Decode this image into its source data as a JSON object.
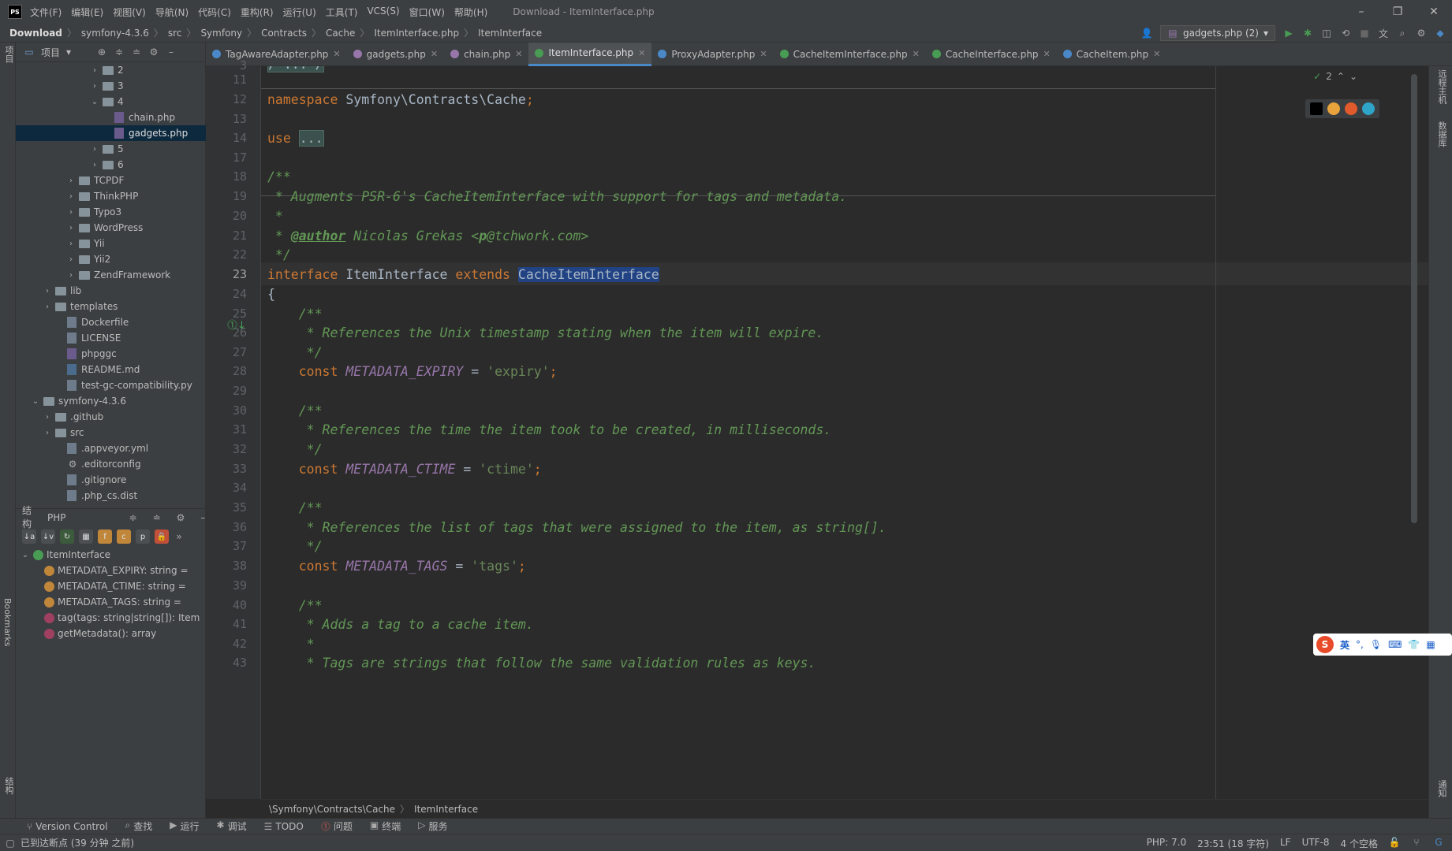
{
  "titlebar": {
    "logo": "PS",
    "menus": [
      "文件(F)",
      "编辑(E)",
      "视图(V)",
      "导航(N)",
      "代码(C)",
      "重构(R)",
      "运行(U)",
      "工具(T)",
      "VCS(S)",
      "窗口(W)",
      "帮助(H)"
    ],
    "window_title": "Download - ItemInterface.php"
  },
  "breadcrumbs": [
    "Download",
    "symfony-4.3.6",
    "src",
    "Symfony",
    "Contracts",
    "Cache",
    "ItemInterface.php",
    "ItemInterface"
  ],
  "run_config": "gadgets.php (2)",
  "left_stripe": {
    "top": "项目",
    "bookmarks": "Bookmarks",
    "structure": "结构"
  },
  "project_panel": {
    "title": "项目",
    "tree": [
      {
        "label": "2",
        "type": "folder",
        "indent": 6,
        "arrow": "›"
      },
      {
        "label": "3",
        "type": "folder",
        "indent": 6,
        "arrow": "›"
      },
      {
        "label": "4",
        "type": "folder",
        "indent": 6,
        "arrow": "⌄"
      },
      {
        "label": "chain.php",
        "type": "php",
        "indent": 7,
        "arrow": ""
      },
      {
        "label": "gadgets.php",
        "type": "php",
        "indent": 7,
        "arrow": "",
        "selected": true
      },
      {
        "label": "5",
        "type": "folder",
        "indent": 6,
        "arrow": "›"
      },
      {
        "label": "6",
        "type": "folder",
        "indent": 6,
        "arrow": "›"
      },
      {
        "label": "TCPDF",
        "type": "folder",
        "indent": 4,
        "arrow": "›"
      },
      {
        "label": "ThinkPHP",
        "type": "folder",
        "indent": 4,
        "arrow": "›"
      },
      {
        "label": "Typo3",
        "type": "folder",
        "indent": 4,
        "arrow": "›"
      },
      {
        "label": "WordPress",
        "type": "folder",
        "indent": 4,
        "arrow": "›"
      },
      {
        "label": "Yii",
        "type": "folder",
        "indent": 4,
        "arrow": "›"
      },
      {
        "label": "Yii2",
        "type": "folder",
        "indent": 4,
        "arrow": "›"
      },
      {
        "label": "ZendFramework",
        "type": "folder",
        "indent": 4,
        "arrow": "›"
      },
      {
        "label": "lib",
        "type": "folder",
        "indent": 2,
        "arrow": "›"
      },
      {
        "label": "templates",
        "type": "folder",
        "indent": 2,
        "arrow": "›"
      },
      {
        "label": "Dockerfile",
        "type": "file",
        "indent": 3,
        "arrow": ""
      },
      {
        "label": "LICENSE",
        "type": "file",
        "indent": 3,
        "arrow": ""
      },
      {
        "label": "phpggc",
        "type": "php",
        "indent": 3,
        "arrow": ""
      },
      {
        "label": "README.md",
        "type": "md",
        "indent": 3,
        "arrow": ""
      },
      {
        "label": "test-gc-compatibility.py",
        "type": "file",
        "indent": 3,
        "arrow": ""
      },
      {
        "label": "symfony-4.3.6",
        "type": "folder",
        "indent": 1,
        "arrow": "⌄"
      },
      {
        "label": ".github",
        "type": "folder",
        "indent": 2,
        "arrow": "›"
      },
      {
        "label": "src",
        "type": "folder",
        "indent": 2,
        "arrow": "›"
      },
      {
        "label": ".appveyor.yml",
        "type": "file",
        "indent": 3,
        "arrow": ""
      },
      {
        "label": ".editorconfig",
        "type": "gear",
        "indent": 3,
        "arrow": ""
      },
      {
        "label": ".gitignore",
        "type": "file",
        "indent": 3,
        "arrow": ""
      },
      {
        "label": ".php_cs.dist",
        "type": "file",
        "indent": 3,
        "arrow": ""
      }
    ]
  },
  "structure_panel": {
    "tabs": [
      "结构",
      "PHP"
    ],
    "root": "ItemInterface",
    "items": [
      "METADATA_EXPIRY: string =",
      "METADATA_CTIME: string =",
      "METADATA_TAGS: string =",
      "tag(tags: string|string[]): Item",
      "getMetadata(): array"
    ]
  },
  "tabs": [
    {
      "label": "TagAwareAdapter.php",
      "color": "#4a88c7",
      "active": false
    },
    {
      "label": "gadgets.php",
      "color": "#9876aa",
      "active": false
    },
    {
      "label": "chain.php",
      "color": "#9876aa",
      "active": false
    },
    {
      "label": "ItemInterface.php",
      "color": "#499c54",
      "active": true
    },
    {
      "label": "ProxyAdapter.php",
      "color": "#4a88c7",
      "active": false
    },
    {
      "label": "CacheItemInterface.php",
      "color": "#499c54",
      "active": false
    },
    {
      "label": "CacheInterface.php",
      "color": "#499c54",
      "active": false
    },
    {
      "label": "CacheItem.php",
      "color": "#4a88c7",
      "active": false
    }
  ],
  "inspection_count": "2",
  "code": {
    "line_numbers": [
      "3",
      "11",
      "12",
      "13",
      "14",
      "17",
      "18",
      "19",
      "20",
      "21",
      "22",
      "23",
      "24",
      "25",
      "26",
      "27",
      "28",
      "29",
      "30",
      "31",
      "32",
      "33",
      "34",
      "35",
      "36",
      "37",
      "38",
      "39",
      "40",
      "41",
      "42",
      "43"
    ],
    "l3": "/*...*/",
    "l12_kw": "namespace",
    "l12_ns": " Symfony\\Contracts\\Cache",
    "l12_end": ";",
    "l14_kw": "use",
    "l14_fold": "...",
    "l18": "/**",
    "l19": " * Augments PSR-6's CacheItemInterface with support for tags and metadata.",
    "l20": " *",
    "l21_a": " * ",
    "l21_tag": "@author",
    "l21_b": " Nicolas Grekas <",
    "l21_p": "p",
    "l21_c": "@tchwork.com>",
    "l22": " */",
    "l23_kw1": "interface",
    "l23_name": " ItemInterface ",
    "l23_kw2": "extends",
    "l23_sp": " ",
    "l23_parent": "CacheItemInterface",
    "l24": "{",
    "l25": "    /**",
    "l26": "     * References the Unix timestamp stating when the item will expire.",
    "l27": "     */",
    "l28_kw": "    const",
    "l28_c": " METADATA_EXPIRY",
    "l28_eq": " = ",
    "l28_s": "'expiry'",
    "l28_end": ";",
    "l30": "    /**",
    "l31": "     * References the time the item took to be created, in milliseconds.",
    "l32": "     */",
    "l33_kw": "    const",
    "l33_c": " METADATA_CTIME",
    "l33_eq": " = ",
    "l33_s": "'ctime'",
    "l33_end": ";",
    "l35": "    /**",
    "l36": "     * References the list of tags that were assigned to the item, as string[].",
    "l37": "     */",
    "l38_kw": "    const",
    "l38_c": " METADATA_TAGS",
    "l38_eq": " = ",
    "l38_s": "'tags'",
    "l38_end": ";",
    "l40": "    /**",
    "l41": "     * Adds a tag to a cache item.",
    "l42": "     *",
    "l43": "     * Tags are strings that follow the same validation rules as keys."
  },
  "editor_breadcrumb": [
    "\\Symfony\\Contracts\\Cache",
    "ItemInterface"
  ],
  "toolwindows": [
    "Version Control",
    "查找",
    "运行",
    "调试",
    "TODO",
    "问题",
    "终端",
    "服务"
  ],
  "status": {
    "left": "已到达断点 (39 分钟 之前)",
    "php": "PHP: 7.0",
    "pos": "23:51 (18 字符)",
    "lf": "LF",
    "enc": "UTF-8",
    "indent": "4 个空格"
  },
  "right_stripe": {
    "top": "远程主机",
    "db": "数据库",
    "notif": "通知"
  },
  "ime": {
    "lang": "英"
  }
}
